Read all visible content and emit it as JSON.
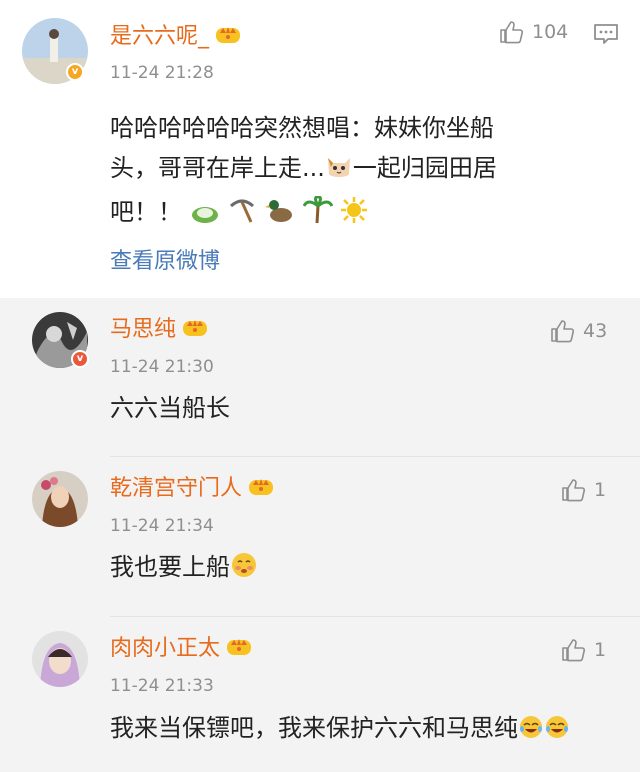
{
  "main_comment": {
    "username": "是六六呢_",
    "timestamp": "11-24 21:28",
    "likes": "104",
    "text_line1": "哈哈哈哈哈哈突然想唱：妹妹你坐船",
    "text_line2": "头，哥哥在岸上走...",
    "text_line2b": "一起归园田居",
    "text_line3": "吧！！",
    "view_original": "查看原微博"
  },
  "replies": [
    {
      "username": "马思纯",
      "timestamp": "11-24 21:30",
      "likes": "43",
      "text": "六六当船长",
      "badge_color": "#e85a3a"
    },
    {
      "username": "乾清宫守门人",
      "timestamp": "11-24 21:34",
      "likes": "1",
      "text": "我也要上船"
    },
    {
      "username": "肉肉小正太",
      "timestamp": "11-24 21:33",
      "likes": "1",
      "text": "我来当保镖吧，我来保护六六和马思纯"
    }
  ],
  "colors": {
    "username": "#e86b1d",
    "link": "#4a7ab8",
    "meta": "#8f8f8f"
  }
}
